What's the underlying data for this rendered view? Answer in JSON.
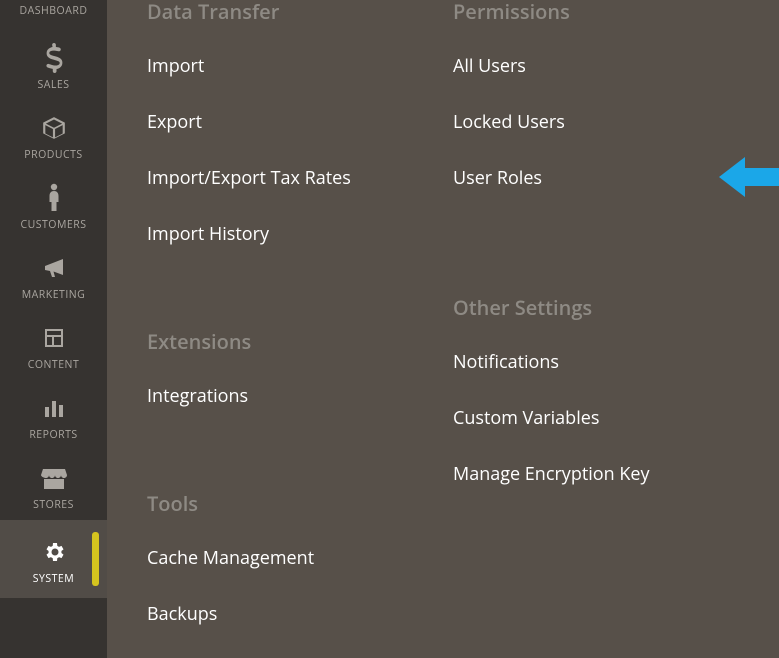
{
  "sidenav": {
    "items": [
      {
        "label": "DASHBOARD",
        "icon": "gauge"
      },
      {
        "label": "SALES",
        "icon": "dollar"
      },
      {
        "label": "PRODUCTS",
        "icon": "box"
      },
      {
        "label": "CUSTOMERS",
        "icon": "person"
      },
      {
        "label": "MARKETING",
        "icon": "megaphone"
      },
      {
        "label": "CONTENT",
        "icon": "layout"
      },
      {
        "label": "REPORTS",
        "icon": "bars"
      },
      {
        "label": "STORES",
        "icon": "storefront"
      },
      {
        "label": "SYSTEM",
        "icon": "gear",
        "active": true
      }
    ]
  },
  "flyout": {
    "col1": [
      {
        "header": "Data Transfer",
        "items": [
          "Import",
          "Export",
          "Import/Export Tax Rates",
          "Import History"
        ]
      },
      {
        "header": "Extensions",
        "items": [
          "Integrations"
        ]
      },
      {
        "header": "Tools",
        "items": [
          "Cache Management",
          "Backups"
        ]
      }
    ],
    "col2": [
      {
        "header": "Permissions",
        "items": [
          "All Users",
          "Locked Users",
          "User Roles"
        ]
      },
      {
        "header": "Other Settings",
        "items": [
          "Notifications",
          "Custom Variables",
          "Manage Encryption Key"
        ]
      }
    ]
  },
  "annotation": {
    "arrow_target": "User Roles",
    "color": "#1ba7e8"
  }
}
